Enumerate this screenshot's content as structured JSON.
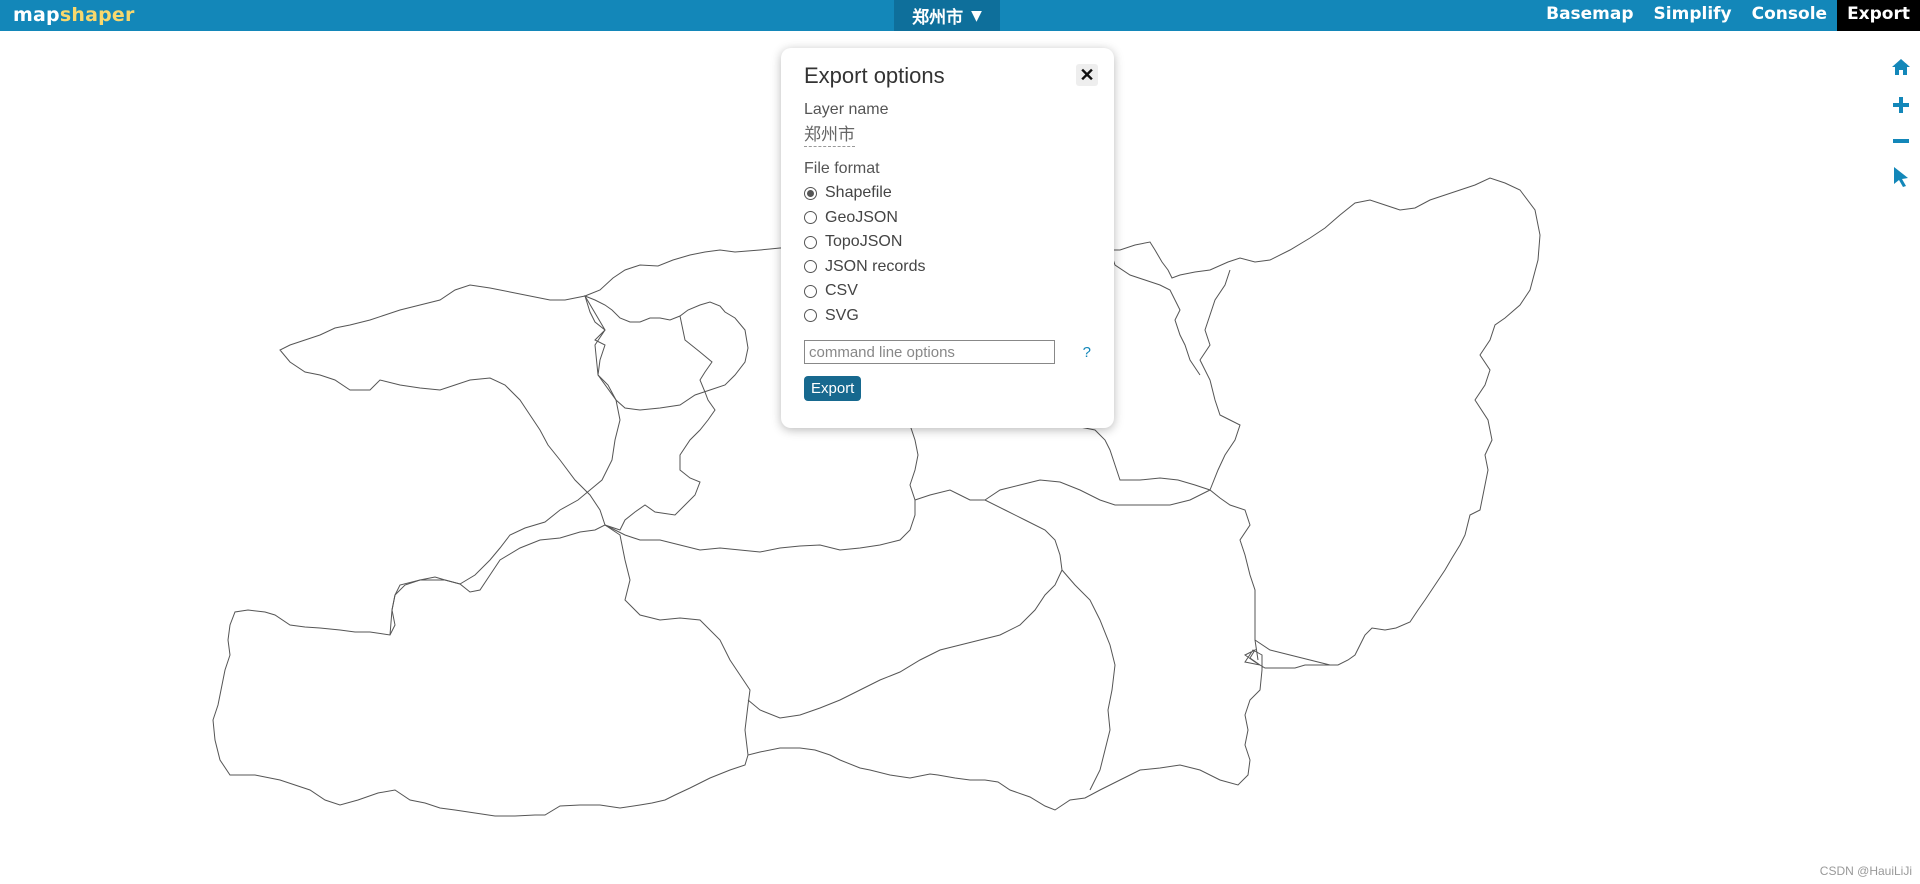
{
  "app": {
    "logo_part1": "map",
    "logo_part2": "shaper",
    "layer_menu_label": "郑州市",
    "layer_menu_arrow": "▼"
  },
  "nav": {
    "items": [
      "Basemap",
      "Simplify",
      "Console",
      "Export"
    ],
    "active": "Export"
  },
  "map_controls": [
    "home-icon",
    "zoom-in-icon",
    "zoom-out-icon",
    "pointer-icon"
  ],
  "export_dialog": {
    "title": "Export options",
    "close_label": "✕",
    "layer_name_label": "Layer name",
    "layer_name_value": "郑州市",
    "file_format_label": "File format",
    "formats": [
      "Shapefile",
      "GeoJSON",
      "TopoJSON",
      "JSON records",
      "CSV",
      "SVG"
    ],
    "selected_format": "Shapefile",
    "command_placeholder": "command line options",
    "help_label": "?",
    "export_button_label": "Export"
  },
  "watermark": "CSDN @HauiLiJi",
  "colors": {
    "topbar": "#1387b9",
    "logo_accent": "#f9d86d",
    "active_nav": "#000000",
    "export_button": "#17698f",
    "map_stroke": "#555555"
  }
}
